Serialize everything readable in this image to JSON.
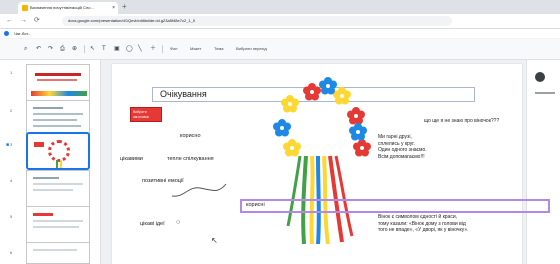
{
  "browser": {
    "tab_title": "Визначення почуттів/емоцій Сло...",
    "tab_close": "×",
    "new_tab": "+",
    "nav": [
      "←",
      "→",
      "⟳"
    ],
    "url": "docs.google.com/presentation/d/1Qevl/edit#slide=id.g23a5f48e7c2_1_0",
    "bookmark": "Чат-бот..."
  },
  "toolbar": {
    "icons": [
      "zoom-icon",
      "undo-icon",
      "redo-icon",
      "print-icon",
      "paint-format-icon",
      "select-icon",
      "textbox-icon",
      "image-icon",
      "shape-icon",
      "line-icon",
      "comment-icon"
    ],
    "glyphs": [
      "⌕",
      "↶",
      "↷",
      "⎙",
      "⊕",
      "↖",
      "T",
      "▣",
      "◯",
      "╲",
      "＋"
    ],
    "text_items": [
      "Фон",
      "Макет",
      "Тема",
      "Вибрати перехід"
    ]
  },
  "filmstrip": {
    "slide_numbers": [
      "1",
      "2",
      "3",
      "4",
      "5",
      "6"
    ]
  },
  "slide": {
    "title": "Очікування",
    "red_note": "Вибрати заголовок",
    "words": {
      "korysno": "корисно",
      "tsikavymy": "цікавими",
      "teple": "тепле спілкування",
      "pozytyvni": "позитивні емоції",
      "tsikavi_idei": "цікаві ідеї",
      "korysni": "корисні"
    },
    "right_text_top": "що ще я не знаю про віночок???",
    "right_text_mid": [
      "Ми гарні друзі,",
      "сплелись у круг.",
      "Один одного знаємо.",
      "Всім допомагаємо!!!"
    ],
    "right_text_bottom": [
      "Вінок є символом єдності й краси,",
      "тому казали: «Вінок дому з голови від",
      "того не впаде», «У дворі, як у віночку»."
    ]
  },
  "colors": {
    "flower_red": "#e53935",
    "flower_blue": "#1e88e5",
    "flower_yellow": "#fdd835",
    "ribbon_green": "#43a047",
    "ribbon_yellow": "#fdd835",
    "ribbon_blue": "#1e88e5",
    "ribbon_red": "#e53935",
    "selection": "#b388eb"
  }
}
